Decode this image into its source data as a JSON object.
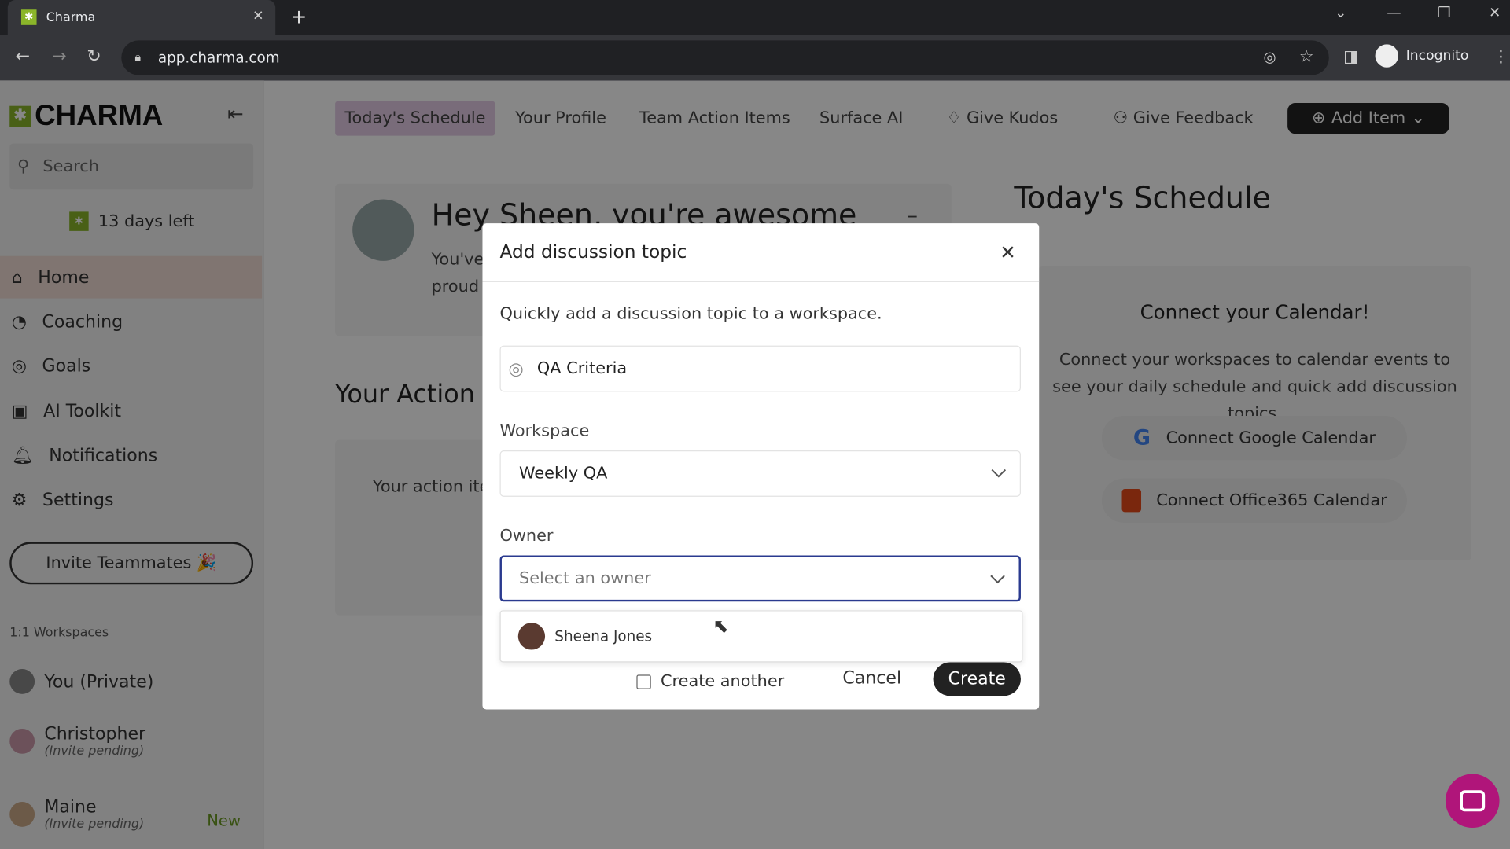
{
  "browser": {
    "tab_title": "Charma",
    "url": "app.charma.com",
    "profile": "Incognito"
  },
  "sidebar": {
    "logo": "CHARMA",
    "search_placeholder": "Search",
    "trial": "13 days left",
    "items": [
      {
        "label": "Home"
      },
      {
        "label": "Coaching"
      },
      {
        "label": "Goals"
      },
      {
        "label": "AI Toolkit"
      },
      {
        "label": "Notifications"
      },
      {
        "label": "Settings"
      }
    ],
    "invite": "Invite Teammates 🎉",
    "workspaces_title": "1:1 Workspaces",
    "workspaces": [
      {
        "name": "You (Private)"
      },
      {
        "name": "Christopher",
        "status": "(Invite pending)"
      },
      {
        "name": "Maine",
        "status": "(Invite pending)",
        "badge": "New"
      }
    ]
  },
  "topnav": {
    "items": [
      "Today's Schedule",
      "Your Profile",
      "Team Action Items",
      "Surface AI",
      "Give Kudos",
      "Give Feedback"
    ],
    "add_item": "Add Item"
  },
  "main": {
    "greeting": "Hey Sheen, you're awesome",
    "greeting_line1": "You've",
    "greeting_line2": "proud",
    "action_title": "Your Action",
    "action_text": "Your action ite",
    "schedule_title": "Today's Schedule",
    "calendar_title": "Connect your Calendar!",
    "calendar_text": "Connect your workspaces to calendar events to see your daily schedule and quick add discussion topics.",
    "google_btn": "Connect Google Calendar",
    "office_btn": "Connect Office365 Calendar"
  },
  "modal": {
    "title": "Add discussion topic",
    "description": "Quickly add a discussion topic to a workspace.",
    "topic_value": "QA Criteria",
    "workspace_label": "Workspace",
    "workspace_value": "Weekly QA",
    "owner_label": "Owner",
    "owner_placeholder": "Select an owner",
    "owner_options": [
      "Sheena Jones"
    ],
    "create_another": "Create another",
    "create_another_checked": false,
    "cancel": "Cancel",
    "create": "Create"
  },
  "colors": {
    "brand_green": "#8bb52a",
    "active_tab": "#e5cde6",
    "focus_border": "#2a3a8f",
    "chat": "#b0157a"
  }
}
